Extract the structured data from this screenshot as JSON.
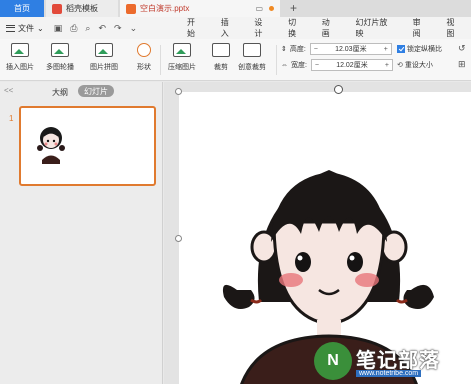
{
  "titlebar": {
    "tab_home": "首页",
    "tab_template": "稻壳模板",
    "tab_doc": "空白演示.pptx",
    "new_tab": "+"
  },
  "menubar": {
    "file_label": "文件",
    "tabs": [
      "开始",
      "插入",
      "设计",
      "切换",
      "动画",
      "幻灯片放映",
      "审阅",
      "视图"
    ]
  },
  "ribbon": {
    "insert_image": "插入图片",
    "multi_outline": "多图轮播",
    "image_collage": "图片拼图",
    "shape": "形状",
    "compress_image": "压缩图片",
    "crop": "裁剪",
    "creative_crop": "创意裁剪",
    "height_label": "高度:",
    "height_value": "12.03厘米",
    "width_label": "宽度:",
    "width_value": "12.02厘米",
    "lock_ratio": "锁定纵横比",
    "reset_size": "重设大小",
    "minus": "−",
    "plus": "+"
  },
  "leftpanel": {
    "collapse": "<<",
    "tab_outline": "大纲",
    "tab_slides": "幻灯片",
    "slide_number": "1"
  },
  "watermark": {
    "title": "笔记部落",
    "site": "www.notetribe.com",
    "logo": "N"
  },
  "colors": {
    "accent": "#2f7fe3",
    "selection": "#e07a2f"
  }
}
